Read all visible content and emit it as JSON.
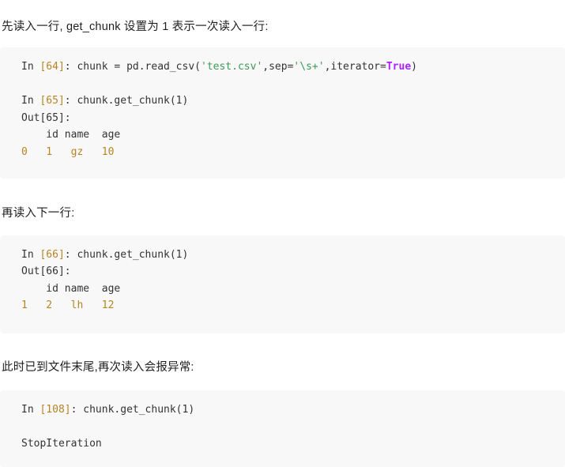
{
  "page": {
    "background_color": "#ffffff",
    "code_background_color": "#f8f8f8",
    "text_color": "#1f1f1f"
  },
  "colors": {
    "string": "#3f9a56",
    "keyword": "#aa22ff",
    "prompt_number": "#b58525",
    "index_value": "#b58525",
    "default": "#333333"
  },
  "paragraphs": {
    "p1": "先读入一行, get_chunk 设置为 1 表示一次读入一行:",
    "p2": "再读入下一行:",
    "p3": "此时已到文件末尾,再次读入会报异常:"
  },
  "code_block_1": {
    "line1": {
      "prompt_in": "In ",
      "prompt_num": "[64]",
      "colon": ": ",
      "code_a": "chunk = pd.read_csv(",
      "str_1": "'test.csv'",
      "code_b": ",sep=",
      "str_2": "'\\s+'",
      "code_c": ",iterator=",
      "kw": "True",
      "code_d": ")"
    },
    "line2": {
      "prompt_in": "In ",
      "prompt_num": "[65]",
      "colon": ": ",
      "code": "chunk.get_chunk(1)"
    },
    "line3": {
      "prompt_out": "Out",
      "prompt_num": "[65]",
      "colon": ":"
    },
    "line4_header": "    id name  age",
    "line5_row": "0   1   gz   10"
  },
  "code_block_2": {
    "line1": {
      "prompt_in": "In ",
      "prompt_num": "[66]",
      "colon": ": ",
      "code": "chunk.get_chunk(1)"
    },
    "line2": {
      "prompt_out": "Out",
      "prompt_num": "[66]",
      "colon": ":"
    },
    "line3_header": "    id name  age",
    "line4_row": "1   2   lh   12"
  },
  "code_block_3": {
    "line1": {
      "prompt_in": "In ",
      "prompt_num": "[108]",
      "colon": ": ",
      "code": "chunk.get_chunk(1)"
    },
    "line2_blank": "",
    "line3_exception": "StopIteration"
  }
}
